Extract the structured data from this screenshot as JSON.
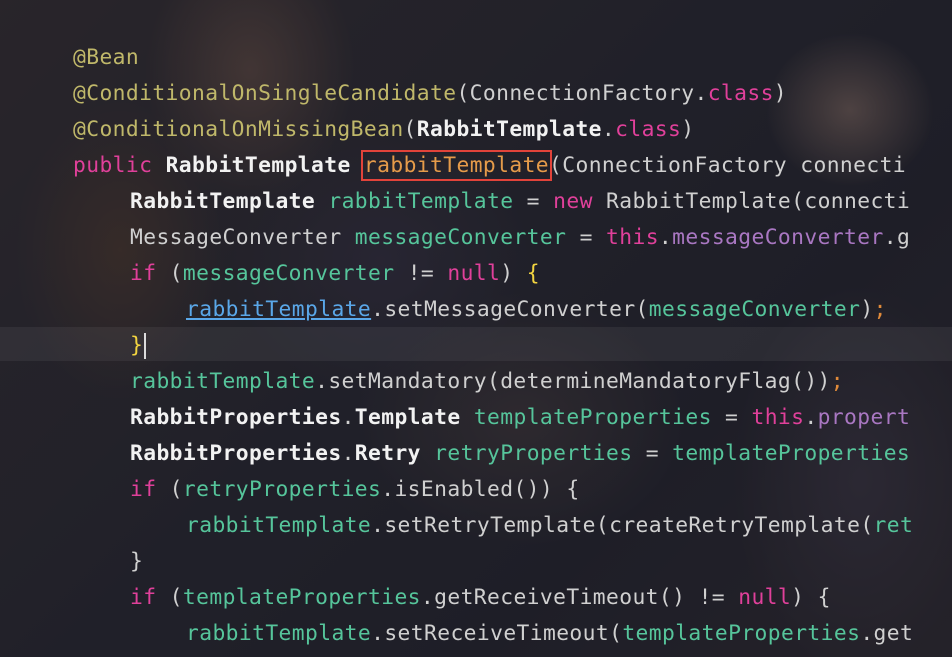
{
  "code": {
    "l1_ann": "@Bean",
    "l2_ann": "@ConditionalOnSingleCandidate",
    "l2_open": "(",
    "l2_type": "ConnectionFactory",
    "l2_dot": ".",
    "l2_class": "class",
    "l2_close": ")",
    "l3_ann": "@ConditionalOnMissingBean",
    "l3_open": "(",
    "l3_type": "RabbitTemplate",
    "l3_dot": ".",
    "l3_class": "class",
    "l3_close": ")",
    "l4_public": "public",
    "l4_type": "RabbitTemplate",
    "l4_method": "rabbitTemplate",
    "l4_rest": "(ConnectionFactory connecti",
    "l5_type": "RabbitTemplate",
    "l5_var": "rabbitTemplate",
    "l5_eq": " = ",
    "l5_new": "new",
    "l5_rest": " RabbitTemplate(connecti",
    "l6_type": "MessageConverter",
    "l6_var": "messageConverter",
    "l6_eq": " = ",
    "l6_this": "this",
    "l6_dot": ".",
    "l6_field": "messageConverter",
    "l6_rest": ".g",
    "l7_if": "if",
    "l7_open": " (",
    "l7_var": "messageConverter",
    "l7_ne": " != ",
    "l7_null": "null",
    "l7_close": ") ",
    "l7_brace": "{",
    "l8_var": "rabbitTemplate",
    "l8_call": ".setMessageConverter(",
    "l8_arg": "messageConverter",
    "l8_close": ")",
    "l8_semi": ";",
    "l9_brace": "}",
    "l10_var": "rabbitTemplate",
    "l10_call": ".setMandatory(determineMandatoryFlag())",
    "l10_semi": ";",
    "l11_type": "RabbitProperties",
    "l11_dot": ".",
    "l11_type2": "Template",
    "l11_var": "templateProperties",
    "l11_eq": " = ",
    "l11_this": "this",
    "l11_dot2": ".",
    "l11_field": "propert",
    "l12_type": "RabbitProperties",
    "l12_dot": ".",
    "l12_type2": "Retry",
    "l12_var": "retryProperties",
    "l12_eq": " = ",
    "l12_rest": "templateProperties",
    "l13_if": "if",
    "l13_open": " (",
    "l13_var": "retryProperties",
    "l13_rest": ".isEnabled()) {",
    "l14_var": "rabbitTemplate",
    "l14_rest": ".setRetryTemplate(createRetryTemplate(",
    "l14_tail": "ret",
    "l15_brace": "}",
    "l16_if": "if",
    "l16_open": " (",
    "l16_var": "templateProperties",
    "l16_rest": ".getReceiveTimeout() != ",
    "l16_null": "null",
    "l16_close": ") {",
    "l17_var": "rabbitTemplate",
    "l17_rest": ".setReceiveTimeout(",
    "l17_arg": "templateProperties",
    "l17_tail": ".get"
  },
  "colors": {
    "annotation": "#c0b86a",
    "keyword": "#e0409a",
    "variable": "#56c59b",
    "type": "#f2f2f2",
    "field": "#a977c2",
    "highlight_box": "#e2433a",
    "brace_match": "#f2d440"
  }
}
